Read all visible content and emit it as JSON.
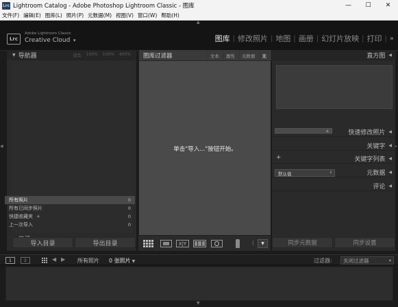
{
  "window": {
    "app_icon": "Lrc",
    "title": "Lightroom Catalog - Adobe Photoshop Lightroom Classic - 图库",
    "controls": {
      "minimize": "—",
      "maximize": "☐",
      "close": "✕"
    }
  },
  "menu": [
    "文件(F)",
    "编辑(E)",
    "图库(L)",
    "照片(P)",
    "元数据(M)",
    "视图(V)",
    "窗口(W)",
    "帮助(H)"
  ],
  "identity": {
    "badge": "Lrc",
    "line1": "Adobe Lightroom Classic",
    "line2": "Creative Cloud",
    "caret": "▾"
  },
  "modules": {
    "items": [
      "图库",
      "修改照片",
      "地图",
      "画册",
      "幻灯片放映",
      "打印"
    ],
    "active": "图库",
    "separator": "|",
    "more": "»"
  },
  "left_panel": {
    "navigator": {
      "title": "导航器",
      "zoom_options": [
        "适合",
        "100%",
        "100%",
        "400%"
      ]
    },
    "catalog": {
      "title": "目录",
      "rows": [
        {
          "label": "所有照片",
          "count": "0",
          "selected": true
        },
        {
          "label": "所有已同步照片",
          "count": "0",
          "selected": false
        },
        {
          "label": "快捷收藏夹",
          "plus": "+",
          "count": "0",
          "selected": false
        },
        {
          "label": "上一次导入",
          "count": "0",
          "selected": false
        }
      ]
    },
    "buttons": {
      "import": "导入目录",
      "export": "导出目录"
    }
  },
  "filter_bar": {
    "label": "图库过滤器",
    "options": [
      "文本",
      "属性",
      "元数据",
      "无"
    ],
    "active": "无"
  },
  "center": {
    "hint": "单击\"导入...\"按钮开始。"
  },
  "toolbar": {
    "xy_label": "X|Y"
  },
  "right_panel": {
    "histogram": {
      "title": "直方图"
    },
    "quick_develop": {
      "title": "快速修改照片"
    },
    "keywording": {
      "title": "关键字"
    },
    "keyword_list": {
      "title": "关键字列表",
      "plus": "+"
    },
    "metadata": {
      "title": "元数据",
      "preset": "默认值"
    },
    "comments": {
      "title": "评论"
    },
    "buttons": {
      "sync_metadata": "同步元数据",
      "sync_settings": "同步设置"
    }
  },
  "filmstrip_bar": {
    "monitor1": "1",
    "monitor2": "2",
    "source": "所有照片",
    "count": "0 张照片",
    "filter_label": "过滤器:",
    "filter_value": "关闭过滤器"
  },
  "colors": {
    "background": "#1b1b1b",
    "panel": "#2a2a2a",
    "center_bg": "#4a4a4a",
    "selected_row": "#494949",
    "active_module": "#e6e6e6"
  }
}
